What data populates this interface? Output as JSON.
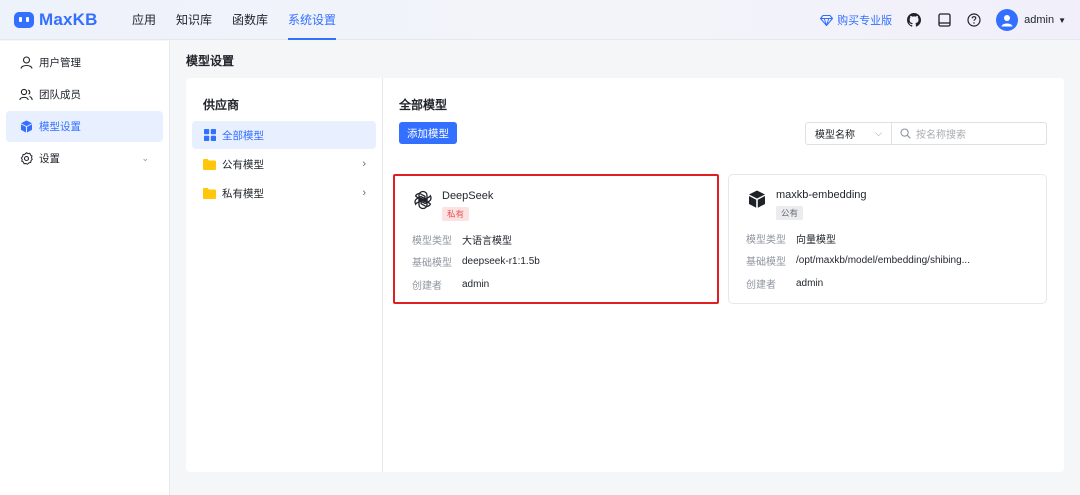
{
  "app": {
    "logo_text": "MaxKB"
  },
  "nav": {
    "items": [
      {
        "label": "应用"
      },
      {
        "label": "知识库"
      },
      {
        "label": "函数库"
      },
      {
        "label": "系统设置"
      }
    ],
    "active": "系统设置"
  },
  "topbar": {
    "buy_label": "购买专业版",
    "user_name": "admin",
    "icons": [
      "diamond-icon",
      "github-icon",
      "document-icon",
      "help-icon",
      "user-avatar-icon",
      "caret-down-icon"
    ]
  },
  "sidebar": {
    "items": [
      {
        "label": "用户管理",
        "icon": "user-icon"
      },
      {
        "label": "团队成员",
        "icon": "team-icon"
      },
      {
        "label": "模型设置",
        "icon": "cube-icon"
      },
      {
        "label": "设置",
        "icon": "gear-icon"
      }
    ],
    "active": "模型设置"
  },
  "page": {
    "title": "模型设置"
  },
  "provider": {
    "title": "供应商",
    "items": [
      {
        "label": "全部模型",
        "icon": "grid-icon"
      },
      {
        "label": "公有模型",
        "icon": "folder-icon"
      },
      {
        "label": "私有模型",
        "icon": "folder-icon"
      }
    ]
  },
  "models": {
    "title": "全部模型",
    "add_label": "添加模型",
    "filter_select": "模型名称",
    "search_placeholder": "按名称搜索",
    "cards": [
      {
        "name": "DeepSeek",
        "badge": "私有",
        "type_key": "模型类型",
        "type_val": "大语言模型",
        "base_key": "基础模型",
        "base_val": "deepseek-r1:1.5b",
        "creator_key": "创建者",
        "creator_val": "admin"
      },
      {
        "name": "maxkb-embedding",
        "badge": "公有",
        "type_key": "模型类型",
        "type_val": "向量模型",
        "base_key": "基础模型",
        "base_val": "/opt/maxkb/model/embedding/shibing...",
        "creator_key": "创建者",
        "creator_val": "admin"
      }
    ]
  },
  "colors": {
    "accent": "#3370ff",
    "highlight": "#e02020",
    "private_badge": "#fde2e2",
    "folder": "#ffc60a"
  }
}
